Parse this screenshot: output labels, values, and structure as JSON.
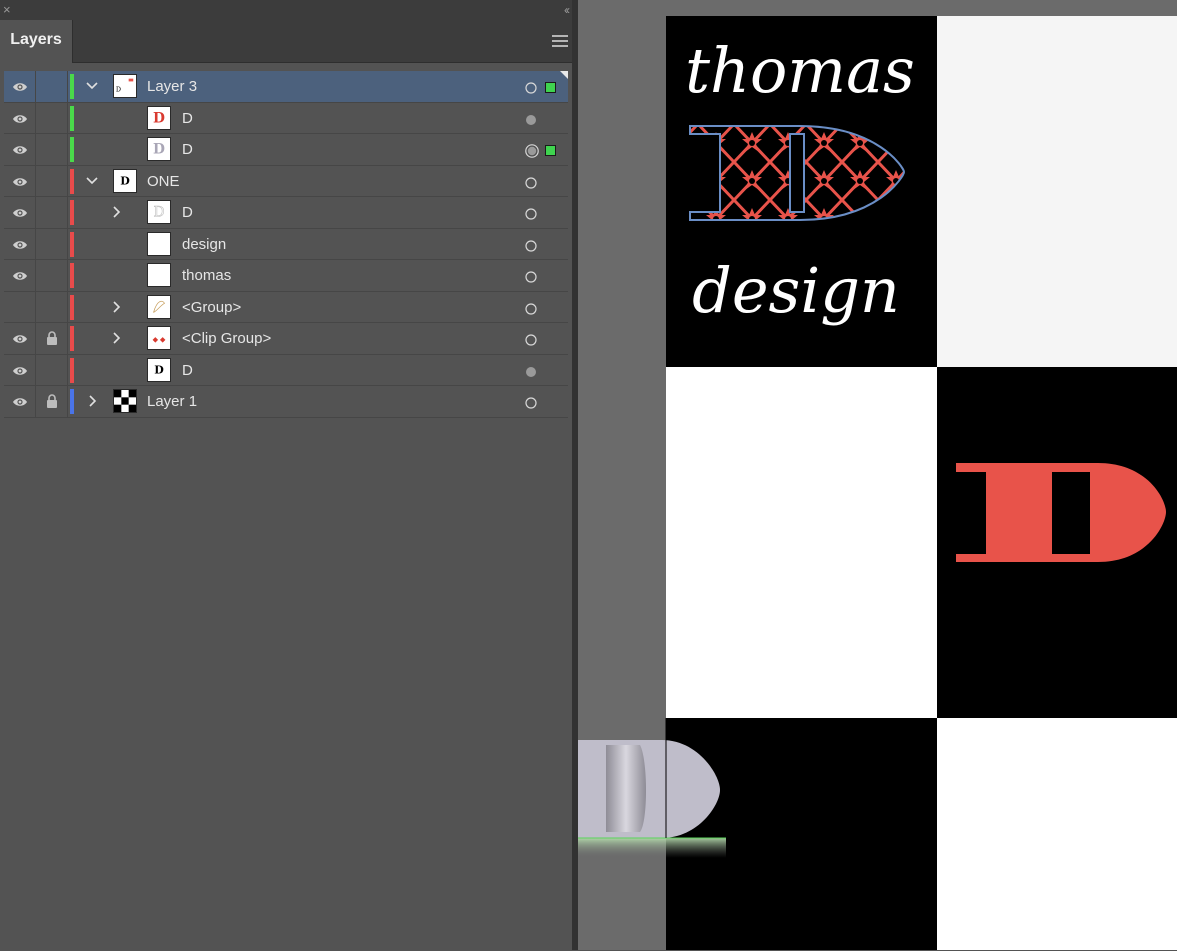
{
  "panel": {
    "close_glyph": "×",
    "collapse_glyph": "‹‹",
    "tab_label": "Layers",
    "menu_icon": "hamburger-icon"
  },
  "layers": [
    {
      "name": "Layer 3",
      "indent": 0,
      "expand": "open",
      "visible": true,
      "locked": false,
      "color": "#4ad94a",
      "selected": true,
      "target": "hollow",
      "selected_square": true,
      "thumb": "layer3"
    },
    {
      "name": "D",
      "indent": 1,
      "expand": "none",
      "visible": true,
      "locked": false,
      "color": "#4ad94a",
      "selected": false,
      "target": "filled",
      "selected_square": false,
      "thumb": "red-d"
    },
    {
      "name": "D",
      "indent": 1,
      "expand": "none",
      "visible": true,
      "locked": false,
      "color": "#4ad94a",
      "selected": false,
      "target": "double",
      "selected_square": true,
      "thumb": "grey-d"
    },
    {
      "name": "ONE",
      "indent": 0,
      "expand": "open",
      "visible": true,
      "locked": false,
      "color": "#e84b4b",
      "selected": false,
      "target": "hollow",
      "selected_square": false,
      "thumb": "black-d"
    },
    {
      "name": "D",
      "indent": 1,
      "expand": "closed",
      "visible": true,
      "locked": false,
      "color": "#e84b4b",
      "selected": false,
      "target": "hollow",
      "selected_square": false,
      "thumb": "outline-d"
    },
    {
      "name": "design",
      "indent": 1,
      "expand": "none",
      "visible": true,
      "locked": false,
      "color": "#e84b4b",
      "selected": false,
      "target": "hollow",
      "selected_square": false,
      "thumb": "blank"
    },
    {
      "name": "thomas",
      "indent": 1,
      "expand": "none",
      "visible": true,
      "locked": false,
      "color": "#e84b4b",
      "selected": false,
      "target": "hollow",
      "selected_square": false,
      "thumb": "blank"
    },
    {
      "name": "<Group>",
      "indent": 1,
      "expand": "closed",
      "visible": false,
      "locked": false,
      "color": "#e84b4b",
      "selected": false,
      "target": "hollow",
      "selected_square": false,
      "thumb": "script"
    },
    {
      "name": "<Clip Group>",
      "indent": 1,
      "expand": "closed",
      "visible": true,
      "locked": true,
      "color": "#e84b4b",
      "selected": false,
      "target": "hollow",
      "selected_square": false,
      "thumb": "clip"
    },
    {
      "name": "D",
      "indent": 1,
      "expand": "none",
      "visible": true,
      "locked": false,
      "color": "#e84b4b",
      "selected": false,
      "target": "filled",
      "selected_square": false,
      "thumb": "black-d"
    },
    {
      "name": "Layer 1",
      "indent": 0,
      "expand": "closed",
      "visible": true,
      "locked": true,
      "color": "#4a74e8",
      "selected": false,
      "target": "hollow",
      "selected_square": false,
      "thumb": "checker"
    }
  ],
  "artwork": {
    "top_word": "thomas",
    "bottom_word": "design",
    "big_letter": "D",
    "accent_color": "#e8534a",
    "pattern_stroke": "#6a8ec6",
    "ghost_color": "#bfbdca"
  }
}
